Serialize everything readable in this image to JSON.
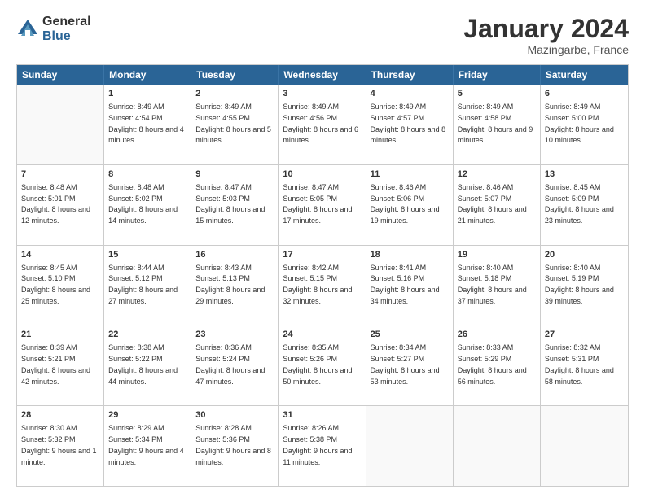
{
  "logo": {
    "general": "General",
    "blue": "Blue"
  },
  "title": "January 2024",
  "location": "Mazingarbe, France",
  "days": [
    "Sunday",
    "Monday",
    "Tuesday",
    "Wednesday",
    "Thursday",
    "Friday",
    "Saturday"
  ],
  "weeks": [
    [
      {
        "day": "",
        "sunrise": "",
        "sunset": "",
        "daylight": ""
      },
      {
        "day": "1",
        "sunrise": "Sunrise: 8:49 AM",
        "sunset": "Sunset: 4:54 PM",
        "daylight": "Daylight: 8 hours and 4 minutes."
      },
      {
        "day": "2",
        "sunrise": "Sunrise: 8:49 AM",
        "sunset": "Sunset: 4:55 PM",
        "daylight": "Daylight: 8 hours and 5 minutes."
      },
      {
        "day": "3",
        "sunrise": "Sunrise: 8:49 AM",
        "sunset": "Sunset: 4:56 PM",
        "daylight": "Daylight: 8 hours and 6 minutes."
      },
      {
        "day": "4",
        "sunrise": "Sunrise: 8:49 AM",
        "sunset": "Sunset: 4:57 PM",
        "daylight": "Daylight: 8 hours and 8 minutes."
      },
      {
        "day": "5",
        "sunrise": "Sunrise: 8:49 AM",
        "sunset": "Sunset: 4:58 PM",
        "daylight": "Daylight: 8 hours and 9 minutes."
      },
      {
        "day": "6",
        "sunrise": "Sunrise: 8:49 AM",
        "sunset": "Sunset: 5:00 PM",
        "daylight": "Daylight: 8 hours and 10 minutes."
      }
    ],
    [
      {
        "day": "7",
        "sunrise": "Sunrise: 8:48 AM",
        "sunset": "Sunset: 5:01 PM",
        "daylight": "Daylight: 8 hours and 12 minutes."
      },
      {
        "day": "8",
        "sunrise": "Sunrise: 8:48 AM",
        "sunset": "Sunset: 5:02 PM",
        "daylight": "Daylight: 8 hours and 14 minutes."
      },
      {
        "day": "9",
        "sunrise": "Sunrise: 8:47 AM",
        "sunset": "Sunset: 5:03 PM",
        "daylight": "Daylight: 8 hours and 15 minutes."
      },
      {
        "day": "10",
        "sunrise": "Sunrise: 8:47 AM",
        "sunset": "Sunset: 5:05 PM",
        "daylight": "Daylight: 8 hours and 17 minutes."
      },
      {
        "day": "11",
        "sunrise": "Sunrise: 8:46 AM",
        "sunset": "Sunset: 5:06 PM",
        "daylight": "Daylight: 8 hours and 19 minutes."
      },
      {
        "day": "12",
        "sunrise": "Sunrise: 8:46 AM",
        "sunset": "Sunset: 5:07 PM",
        "daylight": "Daylight: 8 hours and 21 minutes."
      },
      {
        "day": "13",
        "sunrise": "Sunrise: 8:45 AM",
        "sunset": "Sunset: 5:09 PM",
        "daylight": "Daylight: 8 hours and 23 minutes."
      }
    ],
    [
      {
        "day": "14",
        "sunrise": "Sunrise: 8:45 AM",
        "sunset": "Sunset: 5:10 PM",
        "daylight": "Daylight: 8 hours and 25 minutes."
      },
      {
        "day": "15",
        "sunrise": "Sunrise: 8:44 AM",
        "sunset": "Sunset: 5:12 PM",
        "daylight": "Daylight: 8 hours and 27 minutes."
      },
      {
        "day": "16",
        "sunrise": "Sunrise: 8:43 AM",
        "sunset": "Sunset: 5:13 PM",
        "daylight": "Daylight: 8 hours and 29 minutes."
      },
      {
        "day": "17",
        "sunrise": "Sunrise: 8:42 AM",
        "sunset": "Sunset: 5:15 PM",
        "daylight": "Daylight: 8 hours and 32 minutes."
      },
      {
        "day": "18",
        "sunrise": "Sunrise: 8:41 AM",
        "sunset": "Sunset: 5:16 PM",
        "daylight": "Daylight: 8 hours and 34 minutes."
      },
      {
        "day": "19",
        "sunrise": "Sunrise: 8:40 AM",
        "sunset": "Sunset: 5:18 PM",
        "daylight": "Daylight: 8 hours and 37 minutes."
      },
      {
        "day": "20",
        "sunrise": "Sunrise: 8:40 AM",
        "sunset": "Sunset: 5:19 PM",
        "daylight": "Daylight: 8 hours and 39 minutes."
      }
    ],
    [
      {
        "day": "21",
        "sunrise": "Sunrise: 8:39 AM",
        "sunset": "Sunset: 5:21 PM",
        "daylight": "Daylight: 8 hours and 42 minutes."
      },
      {
        "day": "22",
        "sunrise": "Sunrise: 8:38 AM",
        "sunset": "Sunset: 5:22 PM",
        "daylight": "Daylight: 8 hours and 44 minutes."
      },
      {
        "day": "23",
        "sunrise": "Sunrise: 8:36 AM",
        "sunset": "Sunset: 5:24 PM",
        "daylight": "Daylight: 8 hours and 47 minutes."
      },
      {
        "day": "24",
        "sunrise": "Sunrise: 8:35 AM",
        "sunset": "Sunset: 5:26 PM",
        "daylight": "Daylight: 8 hours and 50 minutes."
      },
      {
        "day": "25",
        "sunrise": "Sunrise: 8:34 AM",
        "sunset": "Sunset: 5:27 PM",
        "daylight": "Daylight: 8 hours and 53 minutes."
      },
      {
        "day": "26",
        "sunrise": "Sunrise: 8:33 AM",
        "sunset": "Sunset: 5:29 PM",
        "daylight": "Daylight: 8 hours and 56 minutes."
      },
      {
        "day": "27",
        "sunrise": "Sunrise: 8:32 AM",
        "sunset": "Sunset: 5:31 PM",
        "daylight": "Daylight: 8 hours and 58 minutes."
      }
    ],
    [
      {
        "day": "28",
        "sunrise": "Sunrise: 8:30 AM",
        "sunset": "Sunset: 5:32 PM",
        "daylight": "Daylight: 9 hours and 1 minute."
      },
      {
        "day": "29",
        "sunrise": "Sunrise: 8:29 AM",
        "sunset": "Sunset: 5:34 PM",
        "daylight": "Daylight: 9 hours and 4 minutes."
      },
      {
        "day": "30",
        "sunrise": "Sunrise: 8:28 AM",
        "sunset": "Sunset: 5:36 PM",
        "daylight": "Daylight: 9 hours and 8 minutes."
      },
      {
        "day": "31",
        "sunrise": "Sunrise: 8:26 AM",
        "sunset": "Sunset: 5:38 PM",
        "daylight": "Daylight: 9 hours and 11 minutes."
      },
      {
        "day": "",
        "sunrise": "",
        "sunset": "",
        "daylight": ""
      },
      {
        "day": "",
        "sunrise": "",
        "sunset": "",
        "daylight": ""
      },
      {
        "day": "",
        "sunrise": "",
        "sunset": "",
        "daylight": ""
      }
    ]
  ]
}
